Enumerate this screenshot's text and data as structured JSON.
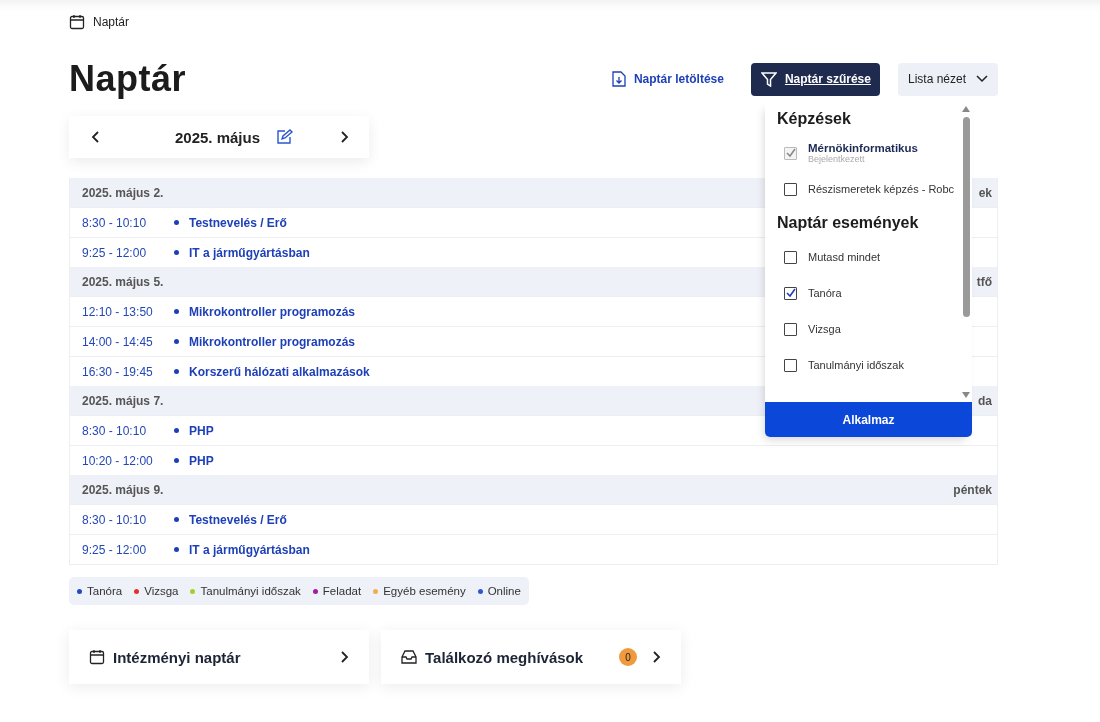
{
  "breadcrumb": "Naptár",
  "title": "Naptár",
  "actions": {
    "download": "Naptár letöltése",
    "filter": "Naptár szűrése",
    "view": "Lista nézet"
  },
  "month_nav": {
    "label": "2025. május"
  },
  "days": [
    {
      "date": "2025. május 2.",
      "weekday": "ek",
      "events": [
        {
          "time": "8:30 - 10:10",
          "title": "Testnevelés / Erő"
        },
        {
          "time": "9:25 - 12:00",
          "title": "IT a járműgyártásban"
        }
      ]
    },
    {
      "date": "2025. május 5.",
      "weekday": "tfő",
      "events": [
        {
          "time": "12:10 - 13:50",
          "title": "Mikrokontroller programozás"
        },
        {
          "time": "14:00 - 14:45",
          "title": "Mikrokontroller programozás"
        },
        {
          "time": "16:30 - 19:45",
          "title": "Korszerű hálózati alkalmazások"
        }
      ]
    },
    {
      "date": "2025. május 7.",
      "weekday": "da",
      "events": [
        {
          "time": "8:30 - 10:10",
          "title": "PHP"
        },
        {
          "time": "10:20 - 12:00",
          "title": "PHP"
        }
      ]
    },
    {
      "date": "2025. május 9.",
      "weekday": "péntek",
      "events": [
        {
          "time": "8:30 - 10:10",
          "title": "Testnevelés / Erő"
        },
        {
          "time": "9:25 - 12:00",
          "title": "IT a járműgyártásban"
        }
      ]
    }
  ],
  "legend": [
    {
      "label": "Tanóra",
      "color": "#1d49c4"
    },
    {
      "label": "Vizsga",
      "color": "#e5302a"
    },
    {
      "label": "Tanulmányi időszak",
      "color": "#a3cf2b"
    },
    {
      "label": "Feladat",
      "color": "#a21aa6"
    },
    {
      "label": "Egyéb esemény",
      "color": "#f4ac4c"
    },
    {
      "label": "Online",
      "color": "#2b59d6"
    }
  ],
  "cards": [
    {
      "kind": "calendar",
      "label": "Intézményi naptár"
    },
    {
      "kind": "invites",
      "label": "Találkozó meghívások",
      "badge": "0"
    }
  ],
  "filter_menu": {
    "sections": [
      {
        "heading": "Képzések",
        "items": [
          {
            "label": "Mérnökinformatikus",
            "sublabel": "Bejelentkezett",
            "checked": true,
            "disabled": true
          },
          {
            "label": "Részismeretek képzés - Robc",
            "checked": false,
            "disabled": false
          }
        ]
      },
      {
        "heading": "Naptár események",
        "items": [
          {
            "label": "Mutasd mindet",
            "checked": false,
            "disabled": false
          },
          {
            "label": "Tanóra",
            "checked": true,
            "disabled": false
          },
          {
            "label": "Vizsga",
            "checked": false,
            "disabled": false
          },
          {
            "label": "Tanulmányi időszak",
            "checked": false,
            "disabled": false
          }
        ]
      }
    ],
    "apply": "Alkalmaz"
  }
}
